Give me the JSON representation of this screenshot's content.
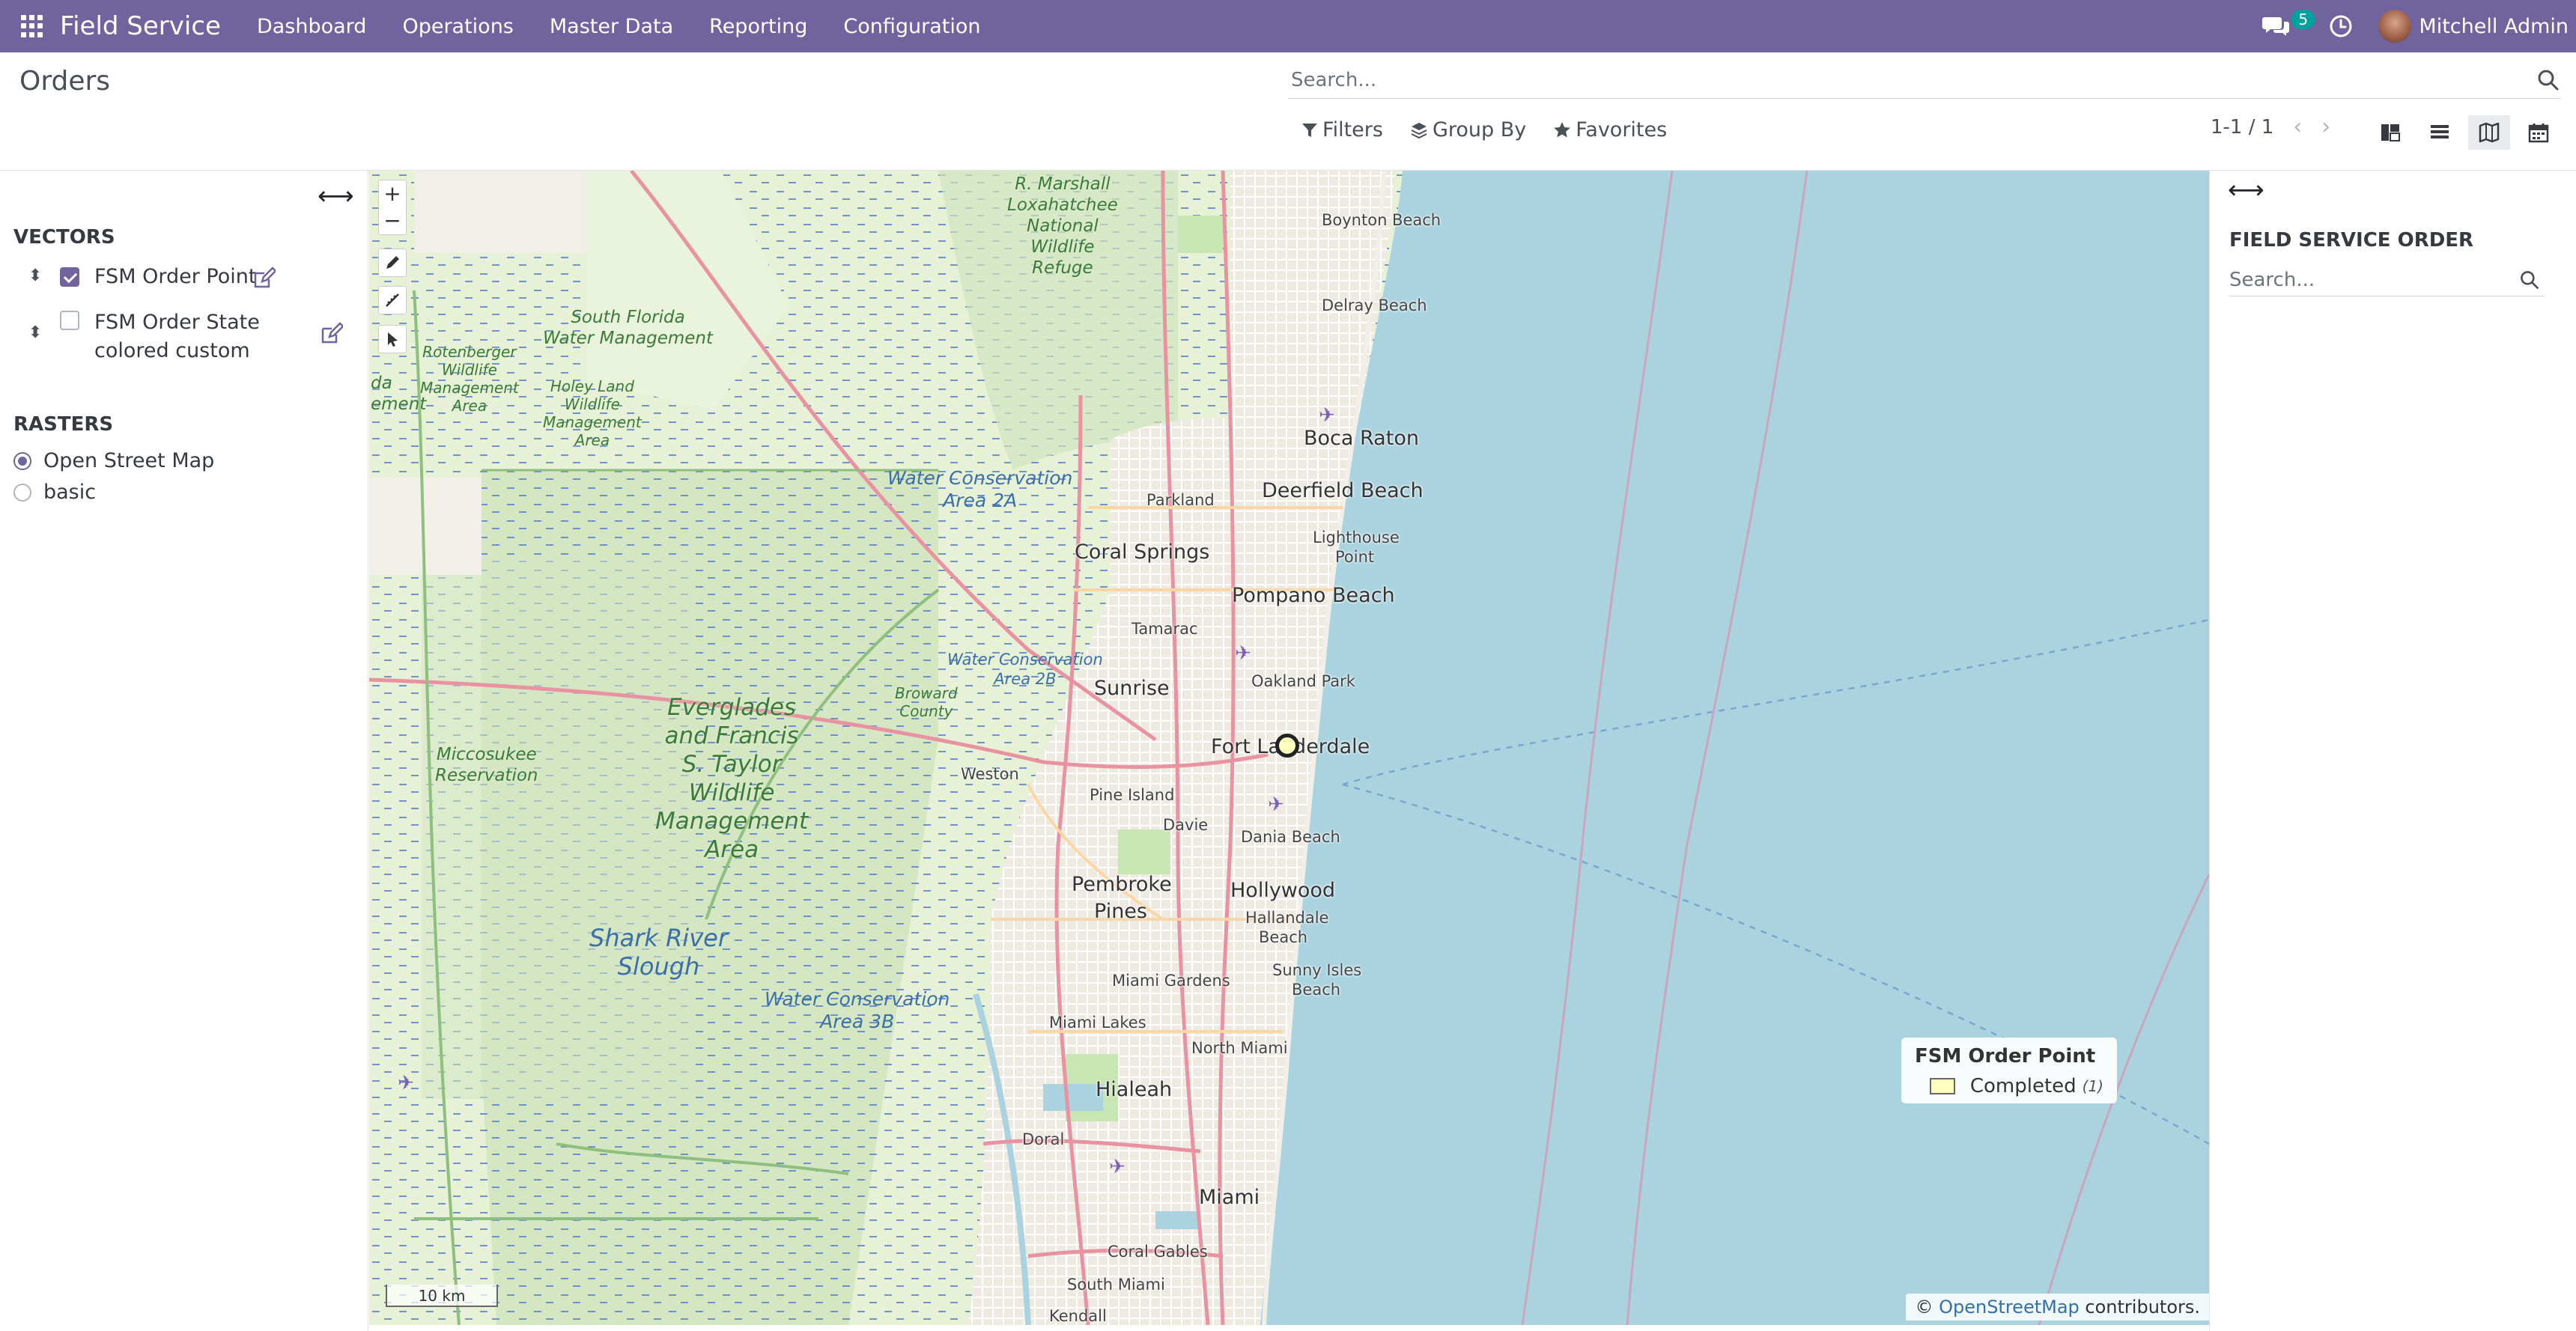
{
  "navbar": {
    "brand": "Field Service",
    "menu": [
      "Dashboard",
      "Operations",
      "Master Data",
      "Reporting",
      "Configuration"
    ],
    "messages_count": "5",
    "user_name": "Mitchell Admin",
    "bg_color": "#71639e"
  },
  "control_panel": {
    "title": "Orders",
    "search_placeholder": "Search...",
    "filters_label": "Filters",
    "group_by_label": "Group By",
    "favorites_label": "Favorites",
    "pager": "1-1 / 1",
    "views": [
      "kanban-icon",
      "list-icon",
      "map-icon",
      "calendar-icon"
    ],
    "active_view": "map"
  },
  "layers_panel": {
    "vectors_title": "VECTORS",
    "vectors": [
      {
        "label": "FSM Order Point",
        "checked": true
      },
      {
        "label_line1": "FSM Order State",
        "label_line2": "colored custom",
        "checked": false
      }
    ],
    "rasters_title": "RASTERS",
    "rasters": [
      {
        "label": "Open Street Map",
        "selected": true
      },
      {
        "label": "basic",
        "selected": false
      }
    ]
  },
  "map": {
    "labels": {
      "boynton_beach": "Boynton Beach",
      "delray_beach": "Delray Beach",
      "boca_raton": "Boca Raton",
      "deerfield_beach": "Deerfield Beach",
      "parkland": "Parkland",
      "coral_springs": "Coral Springs",
      "lighthouse_point_1": "Lighthouse",
      "lighthouse_point_2": "Point",
      "pompano_beach": "Pompano Beach",
      "tamarac": "Tamarac",
      "oakland_park": "Oakland Park",
      "sunrise": "Sunrise",
      "fort_lauderdale": "Fort Lauderdale",
      "weston": "Weston",
      "pine_island": "Pine Island",
      "davie": "Davie",
      "dania_beach": "Dania Beach",
      "pembroke_pines_1": "Pembroke",
      "pembroke_pines_2": "Pines",
      "hollywood": "Hollywood",
      "hallandale_1": "Hallandale",
      "hallandale_2": "Beach",
      "sunny_isles_1": "Sunny Isles",
      "sunny_isles_2": "Beach",
      "miami_gardens": "Miami Gardens",
      "miami_lakes": "Miami Lakes",
      "north_miami": "North Miami",
      "hialeah": "Hialeah",
      "doral": "Doral",
      "miami": "Miami",
      "coral_gables": "Coral Gables",
      "south_miami": "South Miami",
      "kendall": "Kendall",
      "loxahatchee_1": "R. Marshall",
      "loxahatchee_2": "Loxahatchee",
      "loxahatchee_3": "National",
      "loxahatchee_4": "Wildlife",
      "loxahatchee_5": "Refuge",
      "sfwm_1": "South Florida",
      "sfwm_2": "Water Management",
      "rotenberger_1": "Rotenberger",
      "rotenberger_2": "Wildlife",
      "rotenberger_3": "Management",
      "rotenberger_4": "Area",
      "holey_land_1": "Holey Land",
      "holey_land_2": "Wildlife",
      "holey_land_3": "Management",
      "holey_land_4": "Area",
      "wca2a_1": "Water Conservation",
      "wca2a_2": "Area 2A",
      "wca2b_1": "Water Conservation",
      "wca2b_2": "Area 2B",
      "wca3b_1": "Water Conservation",
      "wca3b_2": "Area 3B",
      "broward_1": "Broward",
      "broward_2": "County",
      "everglades_1": "Everglades",
      "everglades_2": "and Francis",
      "everglades_3": "S. Taylor",
      "everglades_4": "Wildlife",
      "everglades_5": "Management",
      "everglades_6": "Area",
      "miccosukee_1": "Miccosukee",
      "miccosukee_2": "Reservation",
      "shark_1": "Shark River",
      "shark_2": "Slough",
      "edge_1": "da",
      "edge_2": "ement"
    },
    "legend": {
      "title": "FSM Order Point",
      "item_label": "Completed",
      "item_count": "(1)",
      "swatch_color": "#ffffbf"
    },
    "scale": "10 km",
    "attribution_prefix": "©",
    "attribution_link": "OpenStreetMap",
    "attribution_suffix": "contributors."
  },
  "right_panel": {
    "title": "FIELD SERVICE ORDER",
    "search_placeholder": "Search..."
  }
}
